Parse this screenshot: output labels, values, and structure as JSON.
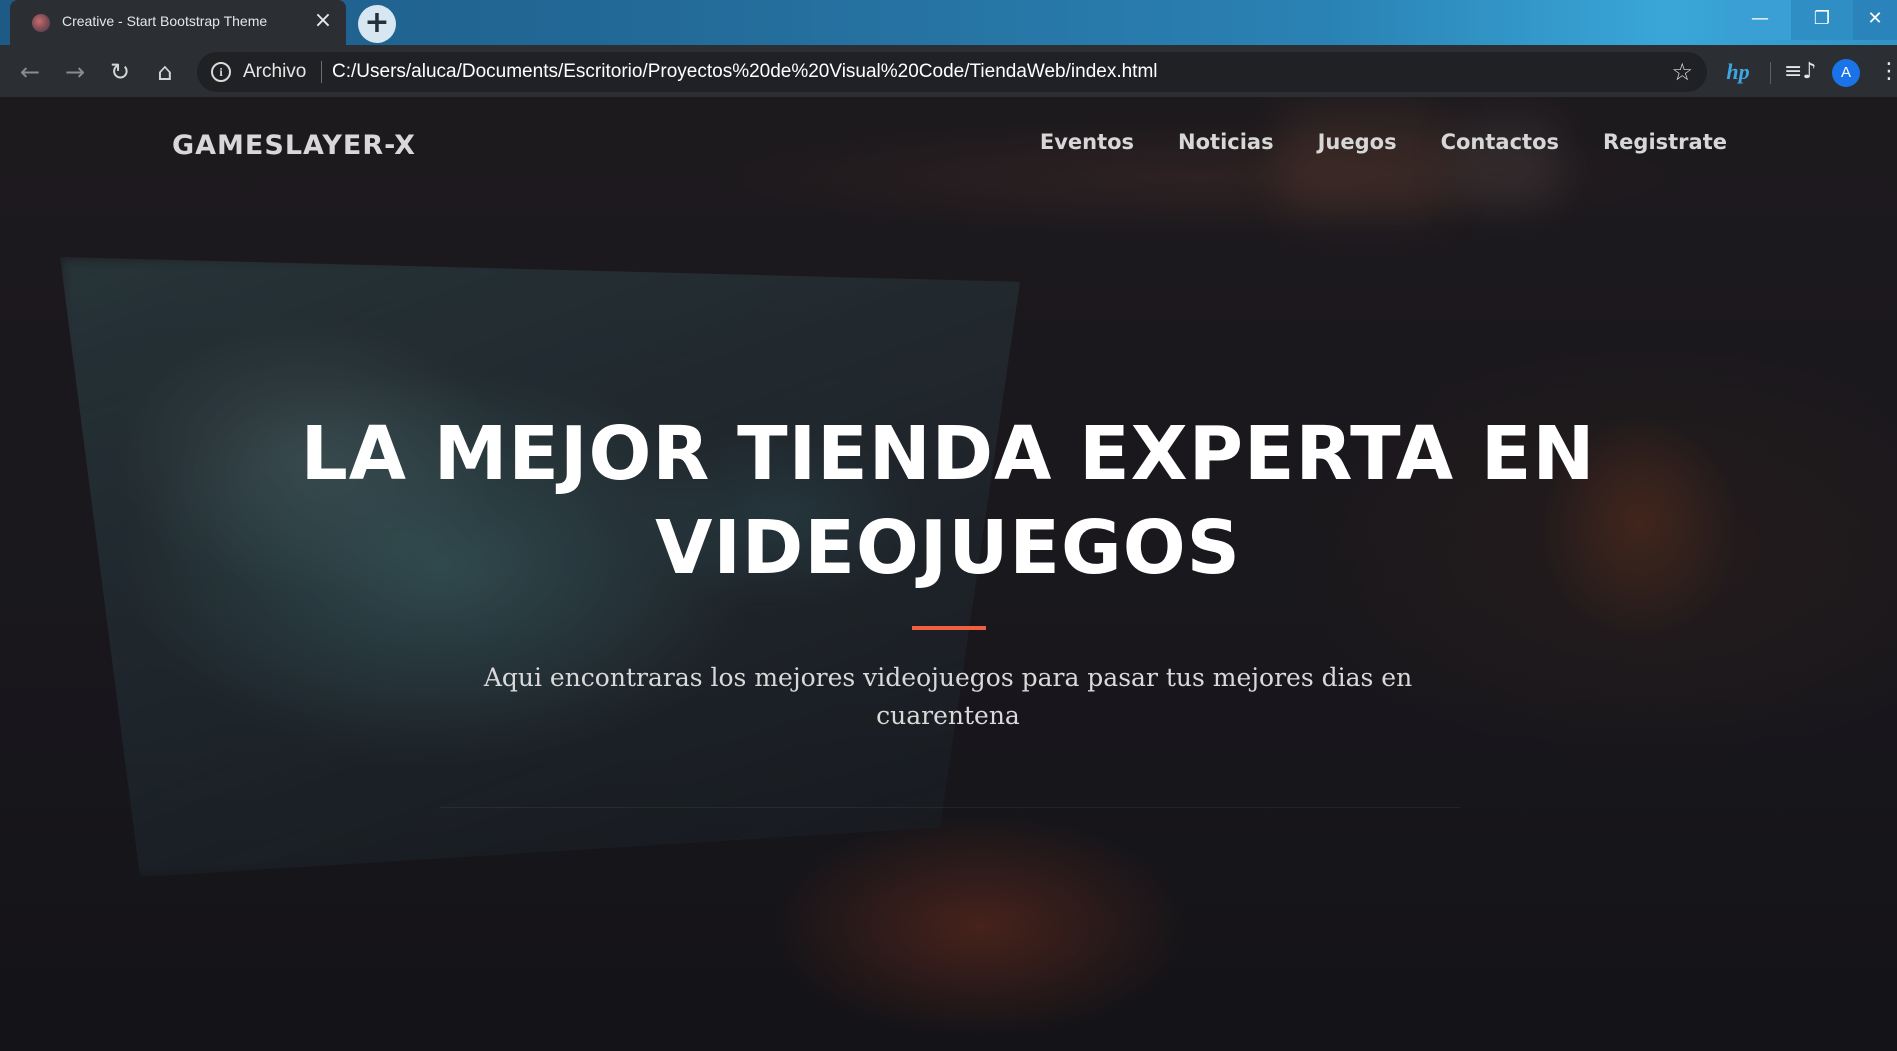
{
  "browser": {
    "tab": {
      "title": "Creative - Start Bootstrap Theme",
      "close_icon": "close-icon",
      "favicon": "site-favicon"
    },
    "new_tab_icon": "plus-icon",
    "window_controls": {
      "minimize_icon": "minimize-icon",
      "restore_icon": "restore-icon",
      "close_icon": "close-icon"
    },
    "toolbar": {
      "back_icon": "back-arrow-icon",
      "forward_icon": "forward-arrow-icon",
      "reload_icon": "reload-icon",
      "home_icon": "home-icon",
      "origin_label": "Archivo",
      "url": "C:/Users/aluca/Documents/Escritorio/Proyectos%20de%20Visual%20Code/TiendaWeb/index.html",
      "bookmark_icon": "star-icon",
      "hp_extension_label": "hp",
      "media_icon": "media-control-icon",
      "profile_initial": "A",
      "menu_icon": "more-vertical-icon"
    },
    "colors": {
      "titlebar": "#236a98",
      "toolbar": "#2b2e33",
      "avatar": "#1a73e8"
    }
  },
  "site": {
    "brand": "GAMESLAYER-X",
    "nav": [
      {
        "label": "Eventos"
      },
      {
        "label": "Noticias"
      },
      {
        "label": "Juegos"
      },
      {
        "label": "Contactos"
      },
      {
        "label": "Registrate"
      }
    ],
    "hero": {
      "title_line1": "LA MEJOR TIENDA EXPERTA EN",
      "title_line2": "VIDEOJUEGOS",
      "subtitle": "Aqui encontraras los mejores videojuegos para pasar tus mejores dias en cuarentena"
    },
    "colors": {
      "accent": "#f05f40",
      "text": "#ffffff"
    }
  }
}
